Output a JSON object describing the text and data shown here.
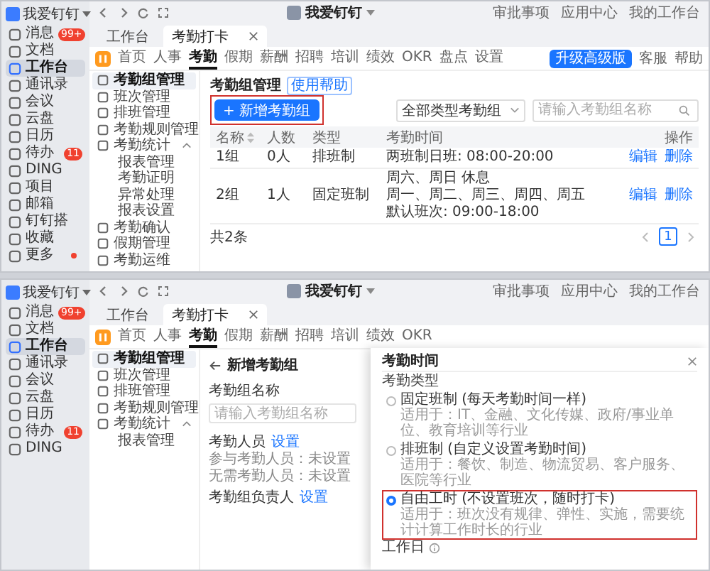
{
  "screens": [
    {
      "org": "我爱钉钉",
      "title": "我爱钉钉",
      "top_links": [
        "审批事项",
        "应用中心",
        "我的工作台"
      ],
      "sidebar": [
        {
          "label": "消息",
          "selected": false,
          "badge": "99+",
          "dot": false
        },
        {
          "label": "文档",
          "selected": false,
          "dot": false
        },
        {
          "label": "工作台",
          "selected": true,
          "dot": false
        },
        {
          "label": "通讯录",
          "selected": false,
          "dot": false
        },
        {
          "label": "会议",
          "selected": false,
          "dot": false
        },
        {
          "label": "云盘",
          "selected": false,
          "dot": false
        },
        {
          "label": "日历",
          "selected": false,
          "dot": false
        },
        {
          "label": "待办",
          "selected": false,
          "badge": "11",
          "dot": false
        },
        {
          "label": "DING",
          "selected": false,
          "dot": false
        },
        {
          "label": "项目",
          "selected": false,
          "dot": false
        },
        {
          "label": "邮箱",
          "selected": false,
          "dot": false
        },
        {
          "label": "钉钉搭",
          "selected": false,
          "dot": false
        },
        {
          "label": "收藏",
          "selected": false,
          "dot": false
        },
        {
          "label": "更多",
          "selected": false,
          "dot": true
        }
      ],
      "tabs": [
        {
          "label": "工作台",
          "selected": false,
          "closable": false
        },
        {
          "label": "考勤打卡",
          "selected": true,
          "closable": true
        }
      ],
      "app_nav": [
        {
          "label": "首页",
          "selected": false
        },
        {
          "label": "人事",
          "selected": false
        },
        {
          "label": "考勤",
          "selected": true
        },
        {
          "label": "假期",
          "selected": false
        },
        {
          "label": "薪酬",
          "selected": false
        },
        {
          "label": "招聘",
          "selected": false
        },
        {
          "label": "培训",
          "selected": false
        },
        {
          "label": "绩效",
          "selected": false
        },
        {
          "label": "OKR",
          "selected": false
        },
        {
          "label": "盘点",
          "selected": false
        },
        {
          "label": "设置",
          "selected": false
        }
      ],
      "app_actions": {
        "upgrade": "升级高级版",
        "service": "客服",
        "help": "帮助"
      },
      "menu": [
        {
          "label": "考勤组管理",
          "selected": true
        },
        {
          "label": "班次管理",
          "selected": false
        },
        {
          "label": "排班管理",
          "selected": false
        },
        {
          "label": "考勤规则管理",
          "selected": false
        },
        {
          "label": "考勤统计",
          "selected": false,
          "expanded": true,
          "children": [
            {
              "label": "报表管理",
              "selected": false
            },
            {
              "label": "考勤证明",
              "selected": false
            },
            {
              "label": "异常处理",
              "selected": false
            },
            {
              "label": "报表设置",
              "selected": false
            }
          ]
        },
        {
          "label": "考勤确认",
          "selected": false
        },
        {
          "label": "假期管理",
          "selected": false
        },
        {
          "label": "考勤运维",
          "selected": false
        }
      ],
      "page": {
        "kind": "list",
        "title": "考勤组管理",
        "tag": "使用帮助",
        "add_button": {
          "label": "+ 新增考勤组",
          "highlighted": true
        },
        "filter": "全部类型考勤组",
        "search": {
          "placeholder": "请输入考勤组名称"
        },
        "table": {
          "columns": [
            {
              "label": "名称",
              "sortable": true
            },
            {
              "label": "人数",
              "sortable": false
            },
            {
              "label": "类型",
              "sortable": false
            },
            {
              "label": "考勤时间",
              "sortable": false
            },
            {
              "label": "操作",
              "sortable": false
            }
          ],
          "rows": [
            {
              "name": "1组",
              "count": "0人",
              "type": "排班制",
              "time": [
                "两班制日班: 08:00-20:00"
              ],
              "actions": [
                "编辑",
                "删除"
              ]
            },
            {
              "name": "2组",
              "count": "1人",
              "type": "固定班制",
              "time": [
                "周六、周日 休息",
                "周一、周二、周三、周四、周五",
                "默认班次: 09:00-18:00"
              ],
              "actions": [
                "编辑",
                "删除"
              ]
            }
          ]
        },
        "total": "共2条",
        "pages": [
          {
            "label": "1",
            "selected": true
          }
        ]
      }
    },
    {
      "org": "我爱钉钉",
      "title": "我爱钉钉",
      "top_links": [
        "审批事项",
        "应用中心",
        "我的工作台"
      ],
      "sidebar": [
        {
          "label": "消息",
          "selected": false,
          "badge": "99+",
          "dot": false
        },
        {
          "label": "文档",
          "selected": false,
          "dot": false
        },
        {
          "label": "工作台",
          "selected": true,
          "dot": false
        },
        {
          "label": "通讯录",
          "selected": false,
          "dot": false
        },
        {
          "label": "会议",
          "selected": false,
          "dot": false
        },
        {
          "label": "云盘",
          "selected": false,
          "dot": false
        },
        {
          "label": "日历",
          "selected": false,
          "dot": false
        },
        {
          "label": "待办",
          "selected": false,
          "badge": "11",
          "dot": false
        },
        {
          "label": "DING",
          "selected": false,
          "dot": false
        }
      ],
      "tabs": [
        {
          "label": "工作台",
          "selected": false,
          "closable": false
        },
        {
          "label": "考勤打卡",
          "selected": true,
          "closable": true
        }
      ],
      "app_nav": [
        {
          "label": "首页",
          "selected": false
        },
        {
          "label": "人事",
          "selected": false
        },
        {
          "label": "考勤",
          "selected": true
        },
        {
          "label": "假期",
          "selected": false
        },
        {
          "label": "薪酬",
          "selected": false
        },
        {
          "label": "招聘",
          "selected": false
        },
        {
          "label": "培训",
          "selected": false
        },
        {
          "label": "绩效",
          "selected": false
        },
        {
          "label": "OKR",
          "selected": false
        }
      ],
      "menu": [
        {
          "label": "考勤组管理",
          "selected": true
        },
        {
          "label": "班次管理",
          "selected": false
        },
        {
          "label": "排班管理",
          "selected": false
        },
        {
          "label": "考勤规则管理",
          "selected": false
        },
        {
          "label": "考勤统计",
          "selected": false,
          "expanded": true,
          "children": [
            {
              "label": "报表管理",
              "selected": false
            }
          ]
        }
      ],
      "page": {
        "kind": "form",
        "back_title": "新增考勤组",
        "name_label": "考勤组名称",
        "name_placeholder": "请输入考勤组名称",
        "members": {
          "label": "考勤人员",
          "link": "设置",
          "lines": [
            "参与考勤人员：未设置",
            "无需考勤人员：未设置"
          ]
        },
        "owner": {
          "label": "考勤组负责人",
          "link": "设置"
        }
      },
      "drawer": {
        "title": "考勤时间",
        "section": "考勤类型",
        "options": [
          {
            "label": "固定班制 (每天考勤时间一样)",
            "desc": "适用于：IT、金融、文化传媒、政府/事业单位、教育培训等行业",
            "selected": false,
            "highlighted": false
          },
          {
            "label": "排班制 (自定义设置考勤时间)",
            "desc": "适用于：餐饮、制造、物流贸易、客户服务、医院等行业",
            "selected": false,
            "highlighted": false
          },
          {
            "label": "自由工时 (不设置班次，随时打卡)",
            "desc": "适用于：班次没有规律、弹性、实施，需要统计计算工作时长的行业",
            "selected": true,
            "highlighted": true
          }
        ],
        "footer": "工作日"
      }
    }
  ]
}
